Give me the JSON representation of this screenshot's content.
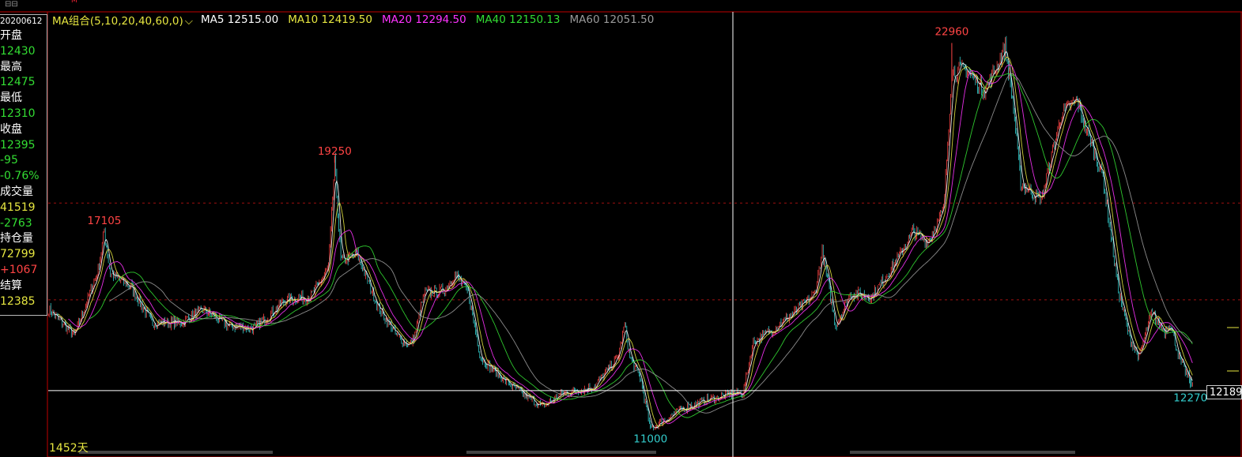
{
  "info_panel": {
    "date": "20200612",
    "rows": [
      {
        "label": "开盘",
        "value": "12430",
        "color": "#33dd33"
      },
      {
        "label": "最高",
        "value": "12475",
        "color": "#33dd33"
      },
      {
        "label": "最低",
        "value": "12310",
        "color": "#33dd33"
      },
      {
        "label": "收盘",
        "value": "12395",
        "color": "#33dd33"
      },
      {
        "label": "",
        "value": "-95",
        "color": "#33dd33"
      },
      {
        "label": "",
        "value": "-0.76%",
        "color": "#33dd33"
      },
      {
        "label": "成交量",
        "value": "41519",
        "color": "#e6e640"
      },
      {
        "label": "",
        "value": "-2763",
        "color": "#33dd33"
      },
      {
        "label": "持仓量",
        "value": "72799",
        "color": "#e6e640"
      },
      {
        "label": "",
        "value": "+1067",
        "color": "#ff4444"
      },
      {
        "label": "结算",
        "value": "12385",
        "color": "#e6e640"
      }
    ]
  },
  "legend": {
    "combo_label": "MA组合(5,10,20,40,60,0)",
    "combo_color": "#e6e640",
    "items": [
      {
        "label": "MA5 12515.00",
        "color": "#ffffff"
      },
      {
        "label": "MA10 12419.50",
        "color": "#e6e640"
      },
      {
        "label": "MA20 12294.50",
        "color": "#ff33ff"
      },
      {
        "label": "MA40 12150.13",
        "color": "#33dd33"
      },
      {
        "label": "MA60 12051.50",
        "color": "#9a9a9a"
      }
    ]
  },
  "current_price": "12189",
  "days_label": "1452天",
  "top_marker": "M",
  "chart_data": {
    "type": "line",
    "ylim": [
      10400,
      23900
    ],
    "crosshair_price": 12189,
    "dashed_levels": [
      18000,
      15000
    ],
    "anchors": [
      [
        0,
        14700
      ],
      [
        25,
        13900
      ],
      [
        48,
        15900
      ],
      [
        54,
        17105
      ],
      [
        60,
        15800
      ],
      [
        80,
        15400
      ],
      [
        100,
        14300
      ],
      [
        130,
        14300
      ],
      [
        150,
        14700
      ],
      [
        175,
        14200
      ],
      [
        200,
        14100
      ],
      [
        230,
        15000
      ],
      [
        255,
        15100
      ],
      [
        272,
        16000
      ],
      [
        278,
        19250
      ],
      [
        284,
        16200
      ],
      [
        300,
        16400
      ],
      [
        320,
        14800
      ],
      [
        338,
        13900
      ],
      [
        350,
        13600
      ],
      [
        355,
        13800
      ],
      [
        365,
        15200
      ],
      [
        385,
        15300
      ],
      [
        395,
        15800
      ],
      [
        408,
        15200
      ],
      [
        420,
        13200
      ],
      [
        440,
        12600
      ],
      [
        460,
        12100
      ],
      [
        480,
        11700
      ],
      [
        500,
        12100
      ],
      [
        530,
        12300
      ],
      [
        553,
        13200
      ],
      [
        560,
        14200
      ],
      [
        565,
        13200
      ],
      [
        575,
        12600
      ],
      [
        585,
        11000
      ],
      [
        600,
        11300
      ],
      [
        615,
        11600
      ],
      [
        640,
        11900
      ],
      [
        665,
        12100
      ],
      [
        675,
        12100
      ],
      [
        685,
        13700
      ],
      [
        700,
        14000
      ],
      [
        725,
        14600
      ],
      [
        745,
        15200
      ],
      [
        752,
        16500
      ],
      [
        765,
        14200
      ],
      [
        780,
        15200
      ],
      [
        800,
        15100
      ],
      [
        820,
        16000
      ],
      [
        840,
        17100
      ],
      [
        855,
        16800
      ],
      [
        870,
        17800
      ],
      [
        878,
        22000
      ],
      [
        890,
        22200
      ],
      [
        910,
        21500
      ],
      [
        930,
        22800
      ],
      [
        937,
        21200
      ],
      [
        945,
        18600
      ],
      [
        965,
        18100
      ],
      [
        985,
        20800
      ],
      [
        1000,
        21200
      ],
      [
        1005,
        20600
      ],
      [
        1012,
        20000
      ],
      [
        1025,
        18800
      ],
      [
        1040,
        15300
      ],
      [
        1050,
        13900
      ],
      [
        1060,
        13200
      ],
      [
        1072,
        14600
      ],
      [
        1085,
        14000
      ],
      [
        1090,
        14300
      ],
      [
        1100,
        13100
      ],
      [
        1110,
        12470
      ],
      [
        1112,
        12395
      ]
    ],
    "labels": [
      {
        "text": "17105",
        "value": 17105,
        "bar": 54,
        "color": "#ff4444"
      },
      {
        "text": "19250",
        "value": 19250,
        "bar": 278,
        "color": "#ff4444"
      },
      {
        "text": "22960",
        "value": 22960,
        "bar": 878,
        "color": "#ff4444"
      },
      {
        "text": "11000",
        "value": 11000,
        "bar": 585,
        "color": "#33cccc"
      },
      {
        "text": "12270",
        "value": 12270,
        "bar": 1110,
        "color": "#33cccc"
      }
    ],
    "moving_averages": [
      {
        "name": "MA5",
        "period": 5,
        "color": "#ffffff"
      },
      {
        "name": "MA10",
        "period": 10,
        "color": "#e6e640"
      },
      {
        "name": "MA20",
        "period": 20,
        "color": "#ff33ff"
      },
      {
        "name": "MA40",
        "period": 40,
        "color": "#33dd33"
      },
      {
        "name": "MA60",
        "period": 60,
        "color": "#9a9a9a"
      }
    ],
    "up_color": "#ff4444",
    "down_color": "#33cccc"
  }
}
